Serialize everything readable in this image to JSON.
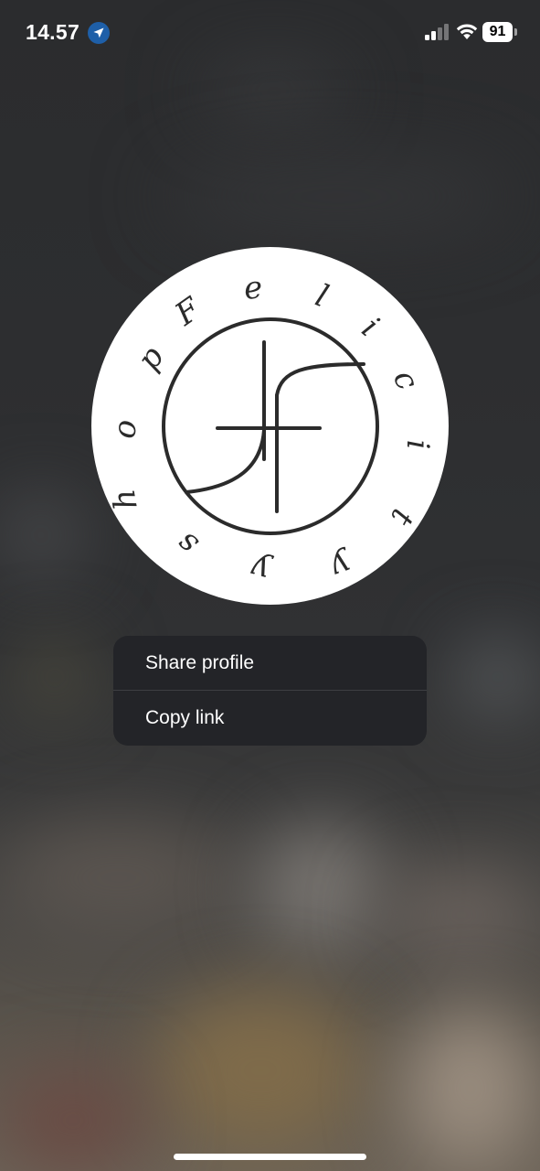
{
  "status_bar": {
    "time": "14.57",
    "battery": "91",
    "icons": [
      "location-arrow-icon",
      "cellular-signal-icon",
      "wifi-icon",
      "battery-icon"
    ]
  },
  "avatar": {
    "logo_text": "Felicity shop",
    "monogram": "JF",
    "background_color": "#ffffff",
    "ink_color": "#2b2b2b"
  },
  "menu": {
    "items": [
      {
        "label": "Share profile"
      },
      {
        "label": "Copy link"
      }
    ]
  },
  "colors": {
    "menu_background": "#232428",
    "text": "#ffffff",
    "location_badge": "#1e5fa8"
  }
}
